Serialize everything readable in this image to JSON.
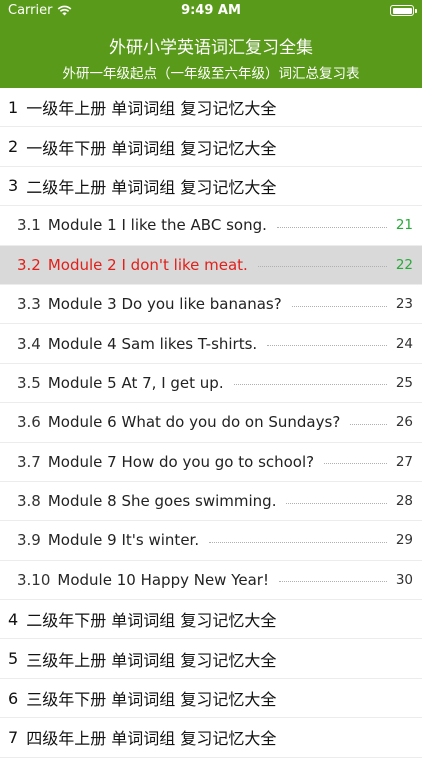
{
  "status_bar": {
    "carrier": "Carrier",
    "time": "9:49 AM"
  },
  "header": {
    "title": "外研小学英语词汇复习全集",
    "subtitle": "外研一年级起点（一年级至六年级）词汇总复习表"
  },
  "rows": [
    {
      "type": "chapter",
      "num": "1",
      "label": "一级年上册  单词词组  复习记忆大全"
    },
    {
      "type": "chapter",
      "num": "2",
      "label": "一级年下册  单词词组  复习记忆大全"
    },
    {
      "type": "chapter",
      "num": "3",
      "label": "二级年上册  单词词组  复习记忆大全"
    },
    {
      "type": "section",
      "num": "3.1",
      "label": "Module 1 I like the ABC song.",
      "page": "21",
      "page_style": "green"
    },
    {
      "type": "section",
      "num": "3.2",
      "label": "Module 2 I don't like meat.",
      "page": "22",
      "selected": true
    },
    {
      "type": "section",
      "num": "3.3",
      "label": "Module 3 Do you like bananas?",
      "page": "23"
    },
    {
      "type": "section",
      "num": "3.4",
      "label": "Module 4 Sam likes T-shirts.",
      "page": "24"
    },
    {
      "type": "section",
      "num": "3.5",
      "label": "Module 5 At 7, I get up.",
      "page": "25"
    },
    {
      "type": "section",
      "num": "3.6",
      "label": "Module 6 What do you do on Sundays?",
      "page": "26"
    },
    {
      "type": "section",
      "num": "3.7",
      "label": "Module 7 How do you go to school?",
      "page": "27"
    },
    {
      "type": "section",
      "num": "3.8",
      "label": "Module 8 She goes swimming.",
      "page": "28"
    },
    {
      "type": "section",
      "num": "3.9",
      "label": "Module 9 It's winter.",
      "page": "29"
    },
    {
      "type": "section",
      "num": "3.10",
      "label": "Module 10 Happy New Year!",
      "page": "30"
    },
    {
      "type": "chapter",
      "num": "4",
      "label": "二级年下册  单词词组  复习记忆大全"
    },
    {
      "type": "chapter",
      "num": "5",
      "label": "三级年上册  单词词组  复习记忆大全"
    },
    {
      "type": "chapter",
      "num": "6",
      "label": "三级年下册  单词词组  复习记忆大全"
    },
    {
      "type": "chapter",
      "num": "7",
      "label": "四级年上册  单词词组  复习记忆大全"
    }
  ],
  "colors": {
    "header_bg": "#5a9a1a",
    "selected_text": "#e0201a",
    "selected_bg": "#d9d9d9",
    "page_highlight": "#2aaa3a"
  },
  "icons": {
    "wifi": "wifi-icon",
    "battery": "battery-icon"
  }
}
